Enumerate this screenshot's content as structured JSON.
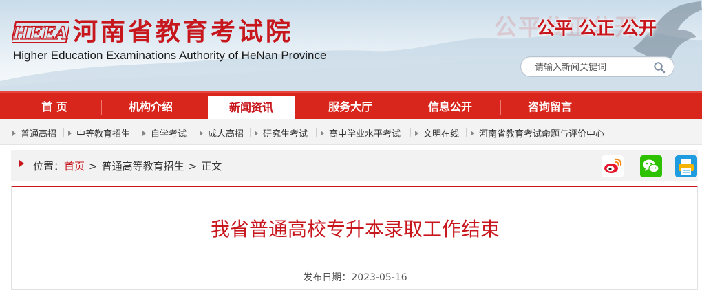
{
  "header": {
    "logo_text": "HEEA",
    "title_cn": "河南省教育考试院",
    "title_en": "Higher Education Examinations Authority of HeNan Province",
    "slogan_ghost": "公平公正公开",
    "slogan": "公平 公正 公开",
    "search_placeholder": "请输入新闻关键词",
    "search_icon": "search-icon"
  },
  "nav": {
    "items": [
      "首 页",
      "机构介绍",
      "新闻资讯",
      "服务大厅",
      "信息公开",
      "咨询留言"
    ],
    "active_index": 2
  },
  "subnav": {
    "items": [
      "普通高招",
      "中等教育招生",
      "自学考试",
      "成人高招",
      "研究生考试",
      "高中学业水平考试",
      "文明在线",
      "河南省教育考试命题与评价中心"
    ]
  },
  "location": {
    "label": "位置：",
    "home": "首页",
    "section": "普通高等教育招生",
    "current": "正文",
    "separator": ">",
    "share_icons": [
      "weibo-icon",
      "wechat-icon",
      "print-icon"
    ]
  },
  "article": {
    "title": "我省普通高校专升本录取工作结束",
    "date_label": "发布日期：",
    "date": "2023-05-16"
  },
  "colors": {
    "brand_red": "#c8161d",
    "nav_red": "#d8261c",
    "weibo": "#e6162d",
    "wechat": "#2dc100",
    "print": "#1f9be0"
  }
}
